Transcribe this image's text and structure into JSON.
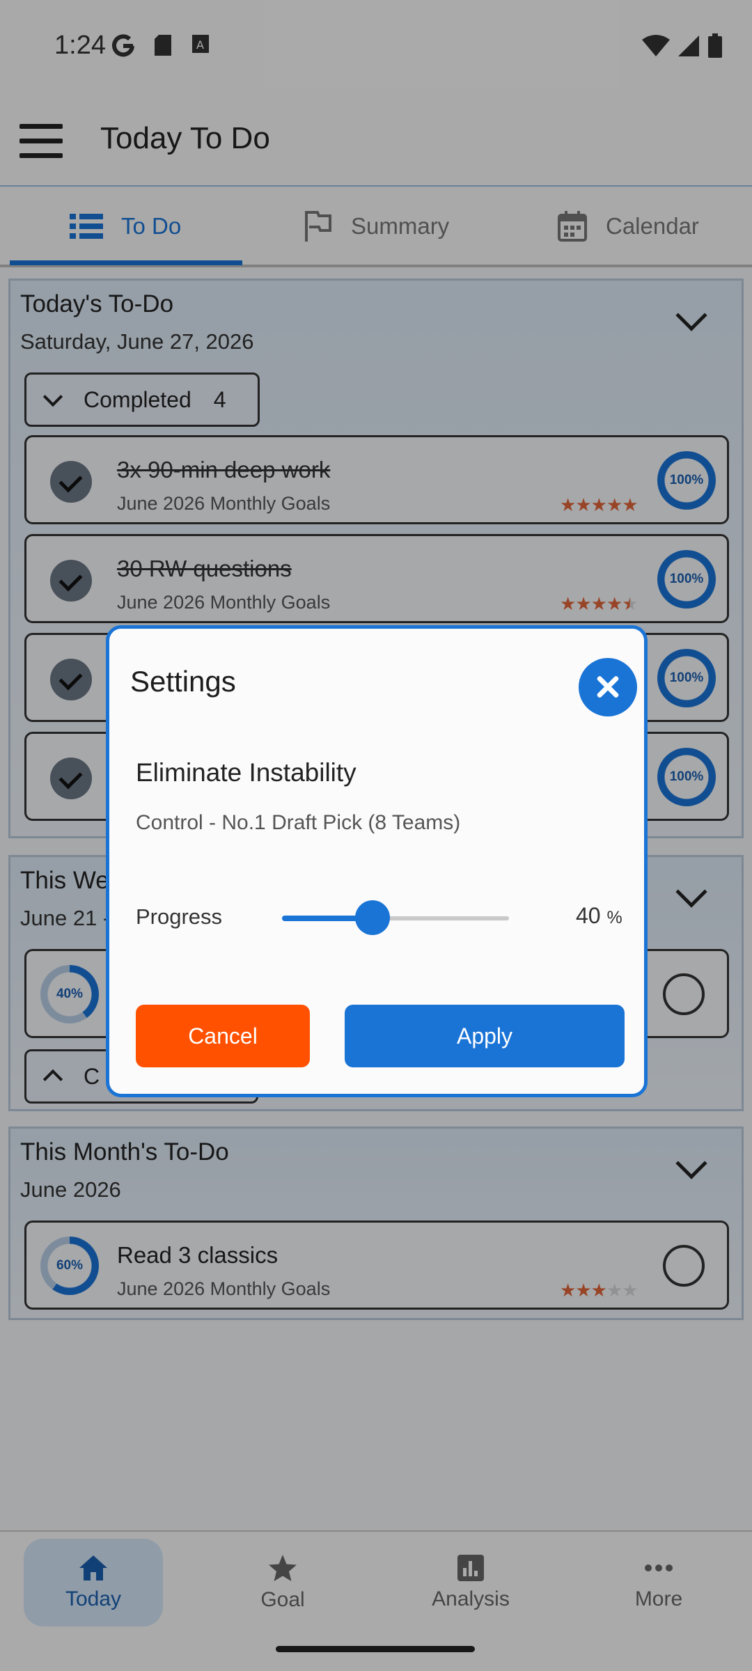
{
  "status_bar": {
    "time": "1:24"
  },
  "app_bar": {
    "title": "Today To Do"
  },
  "tabs": [
    {
      "label": "To Do",
      "active": true
    },
    {
      "label": "Summary",
      "active": false
    },
    {
      "label": "Calendar",
      "active": false
    }
  ],
  "today_section": {
    "title": "Today's To-Do",
    "date": "Saturday, June 27, 2026",
    "completed_label": "Completed",
    "completed_count": "4",
    "tasks": [
      {
        "title": "3x 90-min deep work",
        "subtitle": "June 2026 Monthly Goals",
        "percent": "100%",
        "rating": 5
      },
      {
        "title": "30 RW questions",
        "subtitle": "June 2026 Monthly Goals",
        "percent": "100%",
        "rating": 4.5
      },
      {
        "percent": "100%"
      },
      {
        "percent": "100%"
      }
    ]
  },
  "week_section": {
    "title": "This We",
    "date": "June 21 -",
    "task_percent": "40%",
    "collapse_label": "C"
  },
  "month_section": {
    "title": "This Month's To-Do",
    "date": "June 2026",
    "task": {
      "title": "Read 3 classics",
      "subtitle": "June 2026 Monthly Goals",
      "percent": "60%",
      "rating": 3
    }
  },
  "bottom_nav": [
    {
      "label": "Today",
      "active": true
    },
    {
      "label": "Goal",
      "active": false
    },
    {
      "label": "Analysis",
      "active": false
    },
    {
      "label": "More",
      "active": false
    }
  ],
  "dialog": {
    "title": "Settings",
    "goal_title": "Eliminate Instability",
    "goal_subtitle": "Control - No.1 Draft Pick (8 Teams)",
    "progress_label": "Progress",
    "progress_value": "40",
    "progress_unit": "%",
    "progress_fraction": 0.4,
    "cancel_label": "Cancel",
    "apply_label": "Apply"
  },
  "colors": {
    "accent": "#1a74d6",
    "cancel": "#ff5100",
    "star": "#e0653a"
  }
}
